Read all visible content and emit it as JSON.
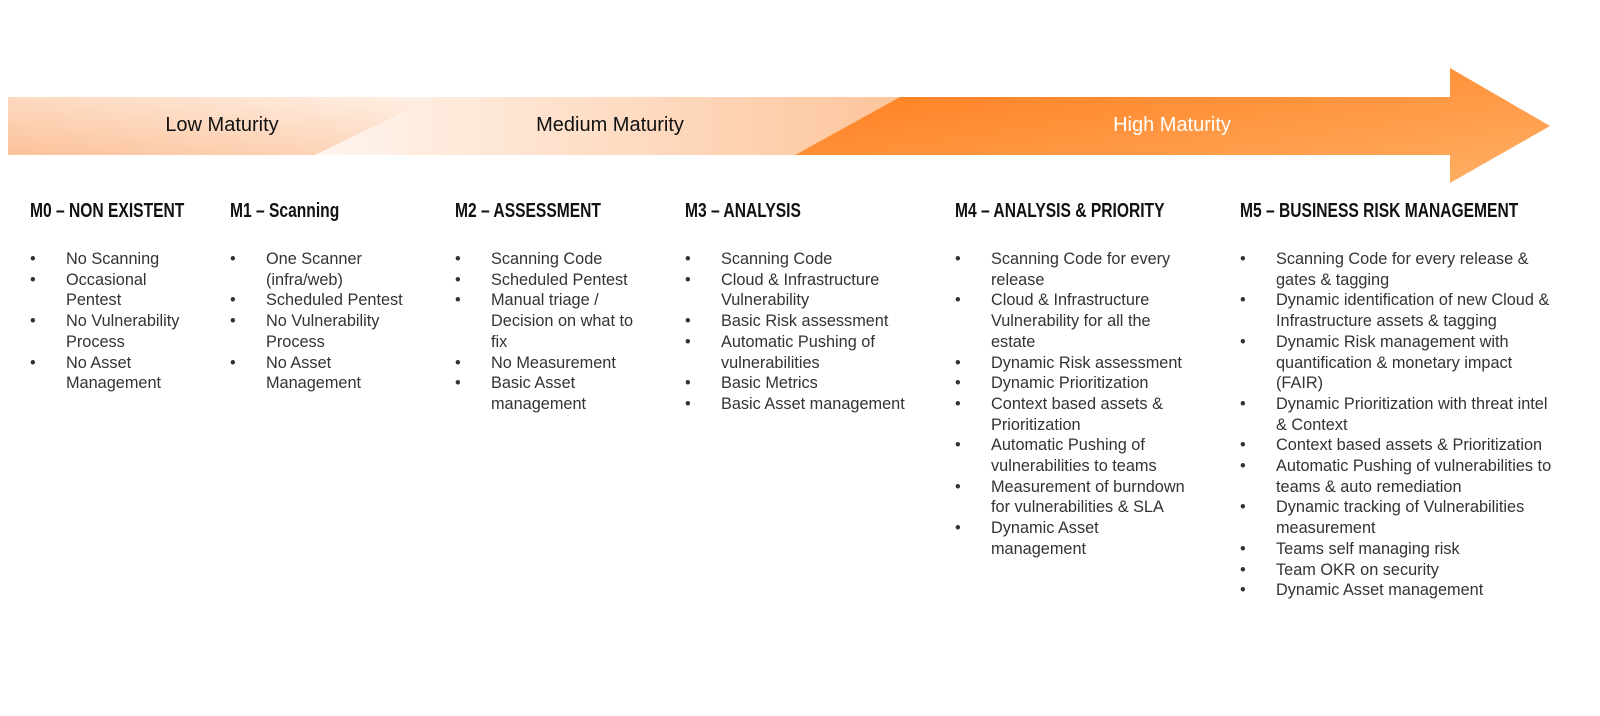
{
  "bands": [
    {
      "label": "Low Maturity"
    },
    {
      "label": "Medium Maturity"
    },
    {
      "label": "High Maturity"
    }
  ],
  "colors": {
    "low": "#fcc9a3",
    "medium": "#fde3cf",
    "high": "#ff7f1f",
    "high_end": "#ffac5c",
    "text": "#333333"
  },
  "columns": [
    {
      "title": "M0 – NON EXISTENT",
      "items": [
        "No Scanning",
        "Occasional Pentest",
        "No Vulnerability Process",
        "No Asset Management"
      ]
    },
    {
      "title": "M1 – Scanning",
      "items": [
        "One Scanner (infra/web)",
        "Scheduled Pentest",
        "No Vulnerability Process",
        "No Asset Management"
      ]
    },
    {
      "title": "M2 – ASSESSMENT",
      "items": [
        "Scanning Code",
        "Scheduled Pentest",
        "Manual triage / Decision on what to fix",
        "No Measurement",
        "Basic Asset management"
      ]
    },
    {
      "title": "M3 – ANALYSIS",
      "items": [
        "Scanning Code",
        "Cloud & Infrastructure Vulnerability",
        "Basic Risk assessment",
        "Automatic Pushing of vulnerabilities",
        "Basic Metrics",
        "Basic Asset management"
      ]
    },
    {
      "title": "M4 – ANALYSIS & PRIORITY",
      "items": [
        "Scanning Code for every release",
        "Cloud & Infrastructure Vulnerability for all the estate",
        "Dynamic Risk assessment",
        "Dynamic Prioritization",
        "Context based assets & Prioritization",
        "Automatic Pushing of vulnerabilities to teams",
        "Measurement of burndown for vulnerabilities & SLA",
        "Dynamic Asset management"
      ]
    },
    {
      "title": "M5 – BUSINESS RISK MANAGEMENT",
      "items": [
        "Scanning Code for every release & gates & tagging",
        "Dynamic identification of new Cloud & Infrastructure assets & tagging",
        "Dynamic Risk management with quantification & monetary impact (FAIR)",
        "Dynamic Prioritization with threat intel & Context",
        "Context based assets & Prioritization",
        "Automatic Pushing of vulnerabilities to teams & auto remediation",
        "Dynamic tracking of Vulnerabilities measurement",
        "Teams self managing risk",
        "Team OKR on security",
        "Dynamic Asset management"
      ]
    }
  ]
}
